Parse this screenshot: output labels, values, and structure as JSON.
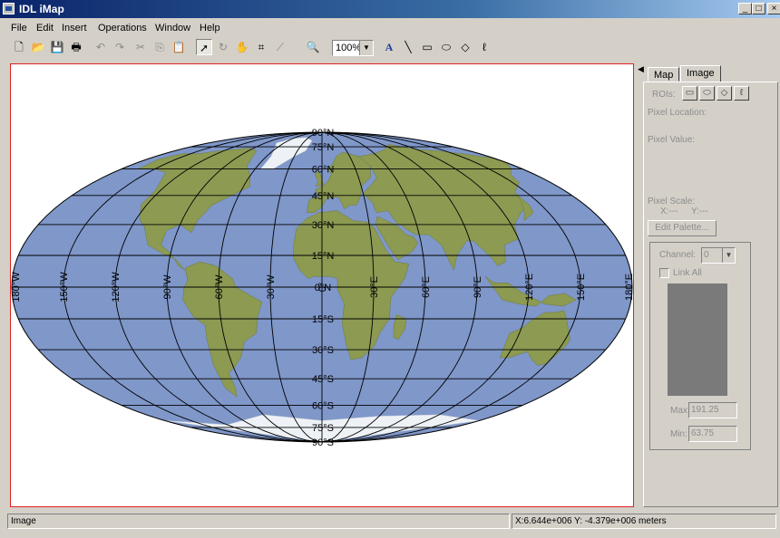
{
  "window": {
    "title": "IDL iMap"
  },
  "window_buttons": [
    "_",
    "□",
    "×"
  ],
  "menu": [
    "File",
    "Edit",
    "Insert",
    "Operations",
    "Window",
    "Help"
  ],
  "toolbar": {
    "zoom_value": "100%",
    "text_tool_glyph": "A"
  },
  "map": {
    "ocean_color": "#7f97c9",
    "land_color": "#8c9a52",
    "ice_color": "#eef2f6",
    "lat_labels": [
      "90°N",
      "75°N",
      "60°N",
      "45°N",
      "30°N",
      "15°N",
      "0°N",
      "15°S",
      "30°S",
      "45°S",
      "60°S",
      "75°S",
      "90°S"
    ],
    "lon_labels": [
      "180°W",
      "150°W",
      "120°W",
      "90°W",
      "60°W",
      "30°W",
      "0°",
      "30°E",
      "60°E",
      "90°E",
      "120°E",
      "150°E",
      "180°E"
    ]
  },
  "panel": {
    "tabs": [
      "Map",
      "Image"
    ],
    "active_tab": "Image",
    "rois_label": "ROIs:",
    "pixel_location_label": "Pixel Location:",
    "pixel_value_label": "Pixel Value:",
    "pixel_scale_label": "Pixel Scale:",
    "scale_x": "X:---",
    "scale_y": "Y:---",
    "edit_palette_button": "Edit Palette...",
    "channel_label": "Channel:",
    "channel_value": "0",
    "link_all_label": "Link All",
    "max_label": "Max:",
    "max_value": "191.25",
    "min_label": "Min:",
    "min_value": "63.75"
  },
  "status": {
    "left": "Image",
    "right": "X:6.644e+006 Y: -4.379e+006 meters"
  }
}
